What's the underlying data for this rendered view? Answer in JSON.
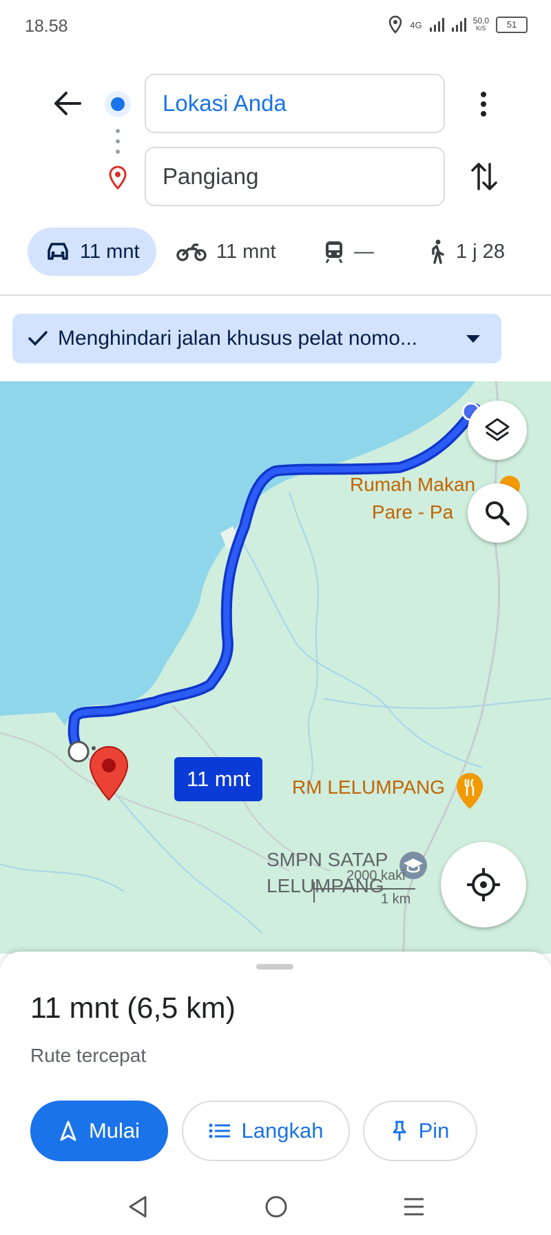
{
  "status_bar": {
    "time": "18.58",
    "network": "4G",
    "speed_value": "50,0",
    "speed_unit": "K/S",
    "battery": "51"
  },
  "search": {
    "origin": "Lokasi Anda",
    "destination": "Pangiang"
  },
  "travel_modes": [
    {
      "mode": "car",
      "label": "11 mnt",
      "icon": "car-icon",
      "active": true
    },
    {
      "mode": "motorcycle",
      "label": "11 mnt",
      "icon": "motorcycle-icon"
    },
    {
      "mode": "transit",
      "label": "—",
      "icon": "train-icon"
    },
    {
      "mode": "walk",
      "label": "1 j 28",
      "icon": "walk-icon"
    }
  ],
  "filter_chip": {
    "label": "Menghindari jalan khusus pelat nomo..."
  },
  "map": {
    "route_eta": "11 mnt",
    "places": [
      {
        "name_line1": "Rumah Makan",
        "name_line2": "Pare - Pa"
      },
      {
        "name_line1": "RM LELUMPANG"
      },
      {
        "name_line1": "SMPN SATAP",
        "name_line2": "LELUMPANG"
      }
    ],
    "scale_imperial": "2000 kaki",
    "scale_metric": "1 km",
    "colors": {
      "water": "#8fd6ea",
      "land": "#cfeedd",
      "route": "#0c35e8",
      "pin": "#ea4335",
      "poi": "#f29900"
    }
  },
  "sheet": {
    "summary": "11 mnt (6,5 km)",
    "subtitle": "Rute tercepat",
    "buttons": {
      "start": "Mulai",
      "steps": "Langkah",
      "pin": "Pin"
    }
  }
}
